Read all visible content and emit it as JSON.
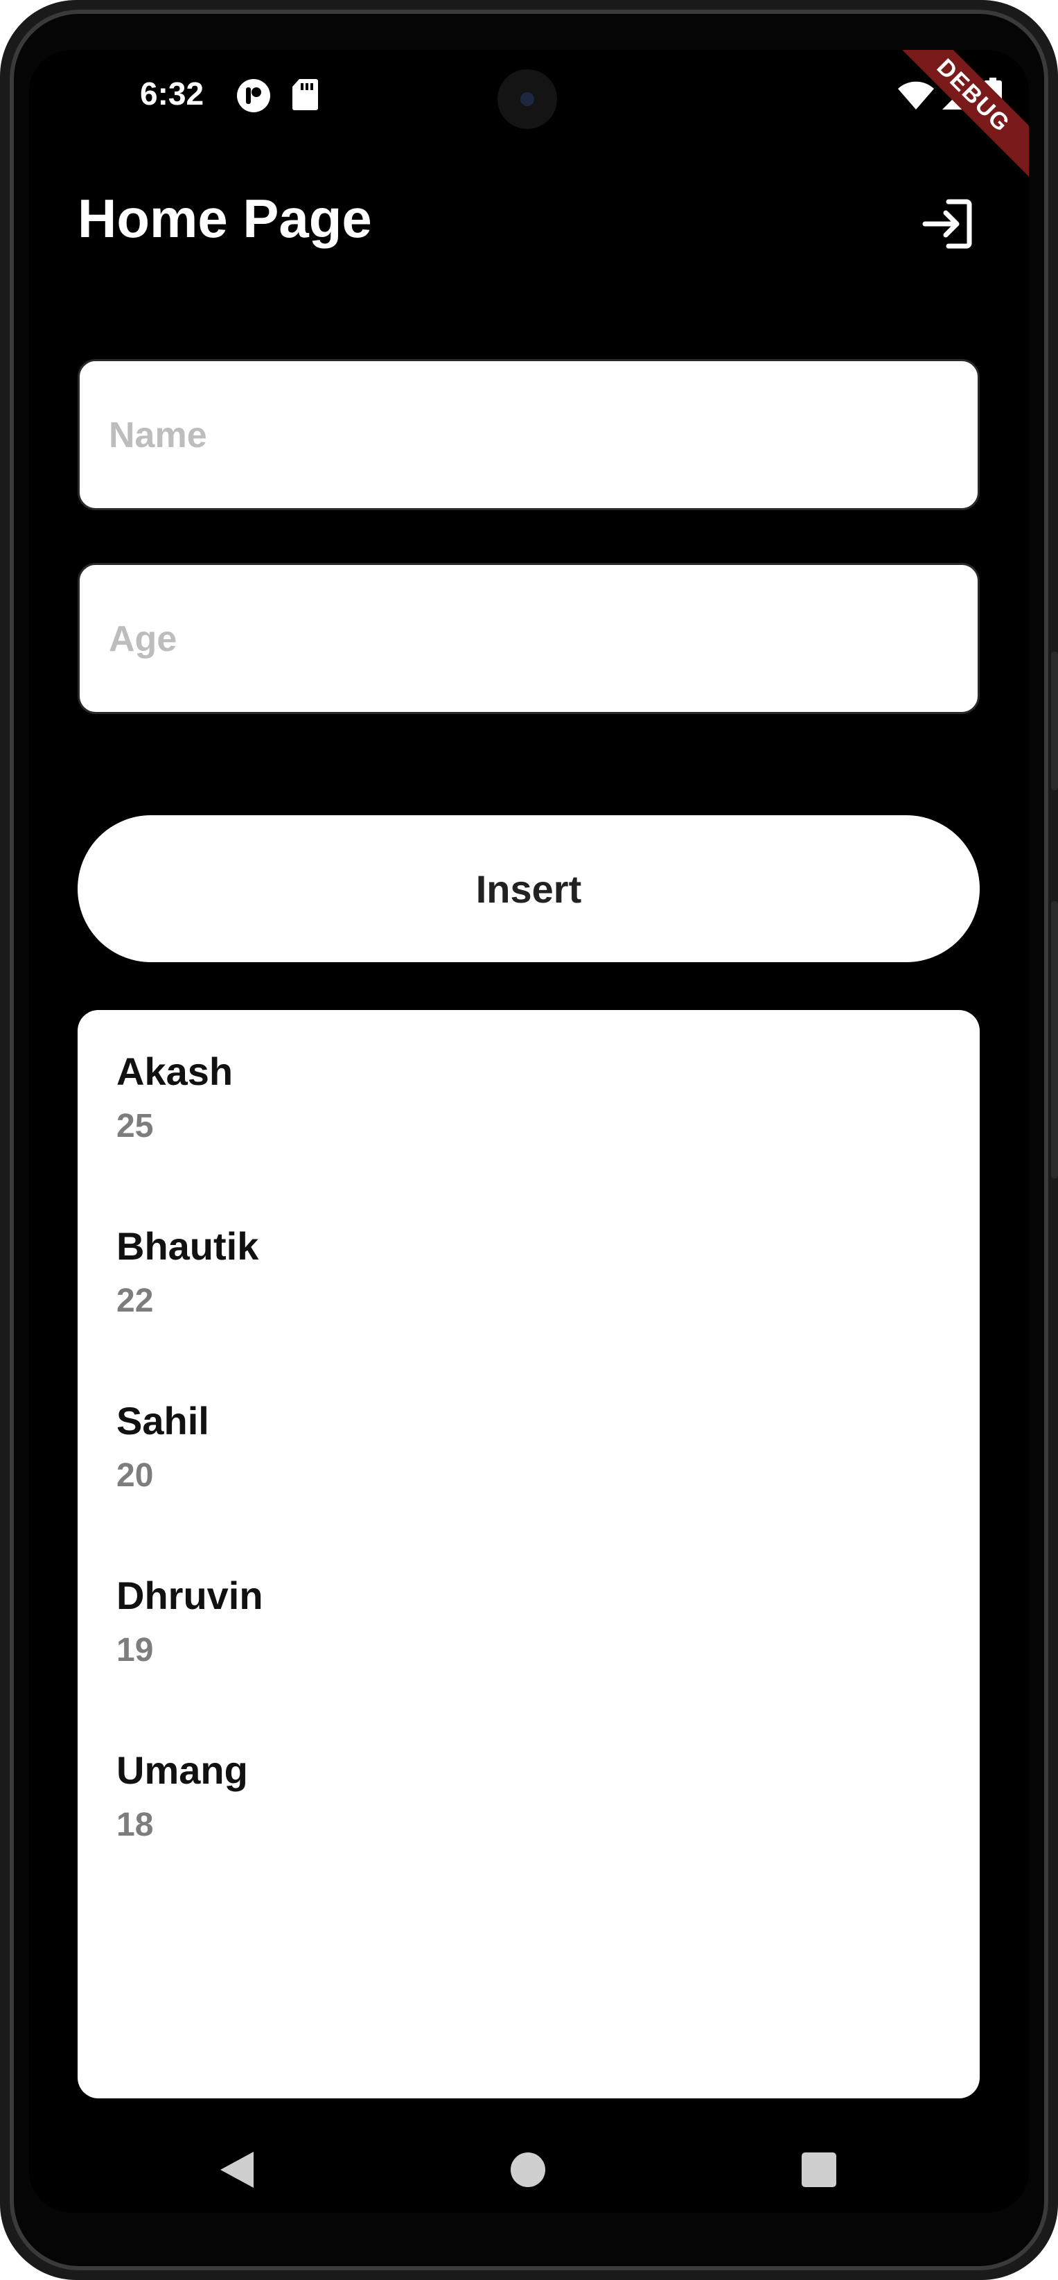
{
  "status_bar": {
    "time": "6:32",
    "icons": [
      "notification-app-icon",
      "sd-card-icon",
      "wifi-icon",
      "signal-icon",
      "battery-icon"
    ]
  },
  "debug_banner": "DEBUG",
  "app_bar": {
    "title": "Home Page",
    "action_icon": "login-icon"
  },
  "form": {
    "name_placeholder": "Name",
    "name_value": "",
    "age_placeholder": "Age",
    "age_value": ""
  },
  "insert_button": {
    "label": "Insert"
  },
  "people": [
    {
      "name": "Akash",
      "age": "25"
    },
    {
      "name": "Bhautik",
      "age": "22"
    },
    {
      "name": "Sahil",
      "age": "20"
    },
    {
      "name": "Dhruvin",
      "age": "19"
    },
    {
      "name": "Umang",
      "age": "18"
    }
  ],
  "nav_bar": {
    "icons": [
      "back-icon",
      "home-icon",
      "recents-icon"
    ]
  },
  "colors": {
    "background": "#000000",
    "card": "#ffffff",
    "secondary_text": "#7d7d7d",
    "placeholder": "#bdbdbd",
    "debug_banner": "#7a1a1a"
  }
}
